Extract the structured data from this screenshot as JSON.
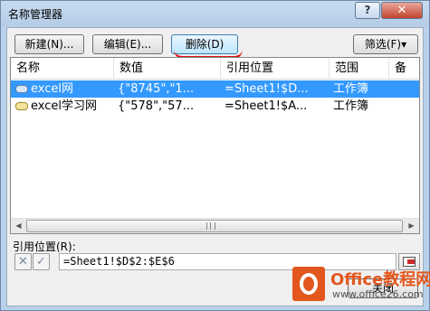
{
  "window": {
    "title": "名称管理器",
    "help_glyph": "?",
    "close_glyph": "✕"
  },
  "toolbar": {
    "new_label": "新建(N)...",
    "edit_label": "编辑(E)...",
    "delete_label": "删除(D)",
    "filter_label": "筛选(F)▾"
  },
  "list": {
    "columns": [
      "名称",
      "数值",
      "引用位置",
      "范围",
      "备"
    ],
    "rows": [
      {
        "name": "excel网",
        "value": "{\"8745\",\"1...",
        "ref": "=Sheet1!$D...",
        "scope": "工作簿",
        "icon": "name-range-icon",
        "selected": true
      },
      {
        "name": "excel学习网",
        "value": "{\"578\",\"57...",
        "ref": "=Sheet1!$A...",
        "scope": "工作簿",
        "icon": "name-range-icon",
        "selected": false
      }
    ],
    "scroll_left": "◀",
    "scroll_right": "▶"
  },
  "ref": {
    "label": "引用位置(R):",
    "value": "=Sheet1!$D$2:$E$6",
    "cancel_glyph": "✕",
    "confirm_glyph": "✓"
  },
  "footer": {
    "close_label": "关闭"
  },
  "watermark": {
    "brand": "Office教程网",
    "url": "www.office26.com"
  },
  "colors": {
    "selection": "#3399ff",
    "annotation": "#e01010",
    "brand": "#e2571d"
  }
}
